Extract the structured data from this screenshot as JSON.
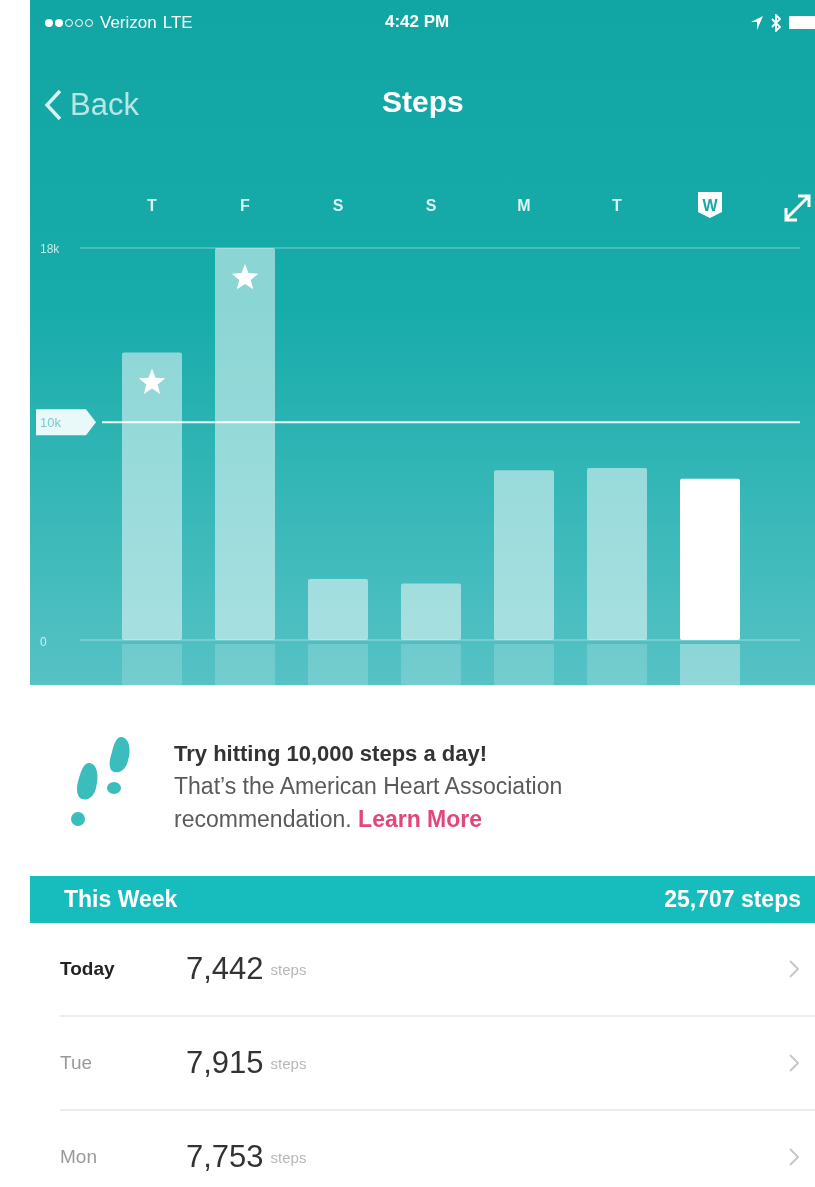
{
  "status_bar": {
    "carrier": "Verizon",
    "network": "LTE",
    "time": "4:42 PM"
  },
  "nav": {
    "back": "Back",
    "title": "Steps"
  },
  "chart": {
    "days": [
      {
        "selected": false,
        "star": true
      },
      {
        "selected": false,
        "star": true
      },
      {
        "selected": false,
        "star": false
      },
      {
        "selected": false,
        "star": false
      },
      {
        "selected": false,
        "star": false
      },
      {
        "selected": false,
        "star": false
      },
      {
        "selected": true,
        "star": false
      }
    ],
    "chart_data": {
      "type": "bar",
      "categories": [
        "T",
        "F",
        "S",
        "S",
        "M",
        "T",
        "W"
      ],
      "values": [
        13200,
        18000,
        2800,
        2600,
        7800,
        7900,
        7400
      ],
      "ylim": [
        0,
        18000
      ],
      "yticks": [
        {
          "value": 0,
          "label": "0"
        },
        {
          "value": 10000,
          "label": "10k"
        },
        {
          "value": 18000,
          "label": "18k"
        }
      ]
    }
  },
  "tip": {
    "title": "Try hitting 10,000 steps a day!",
    "body": "That’s the American Heart Association recommendation.",
    "link": "Learn More"
  },
  "week": {
    "title": "This Week",
    "total": "25,707 steps",
    "rows": [
      {
        "day": "Today",
        "count": "7,442",
        "unit": "steps",
        "current": true
      },
      {
        "day": "Tue",
        "count": "7,915",
        "unit": "steps",
        "current": false
      },
      {
        "day": "Mon",
        "count": "7,753",
        "unit": "steps",
        "current": false
      }
    ]
  }
}
